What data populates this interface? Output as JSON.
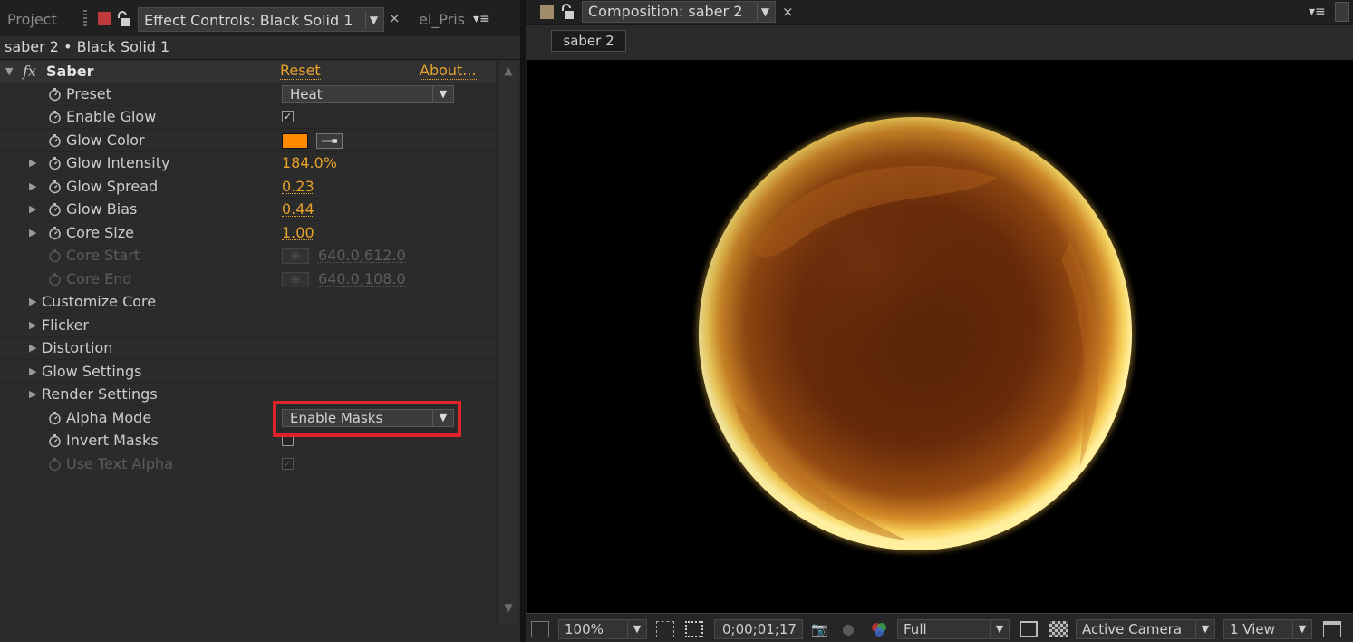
{
  "left_panel": {
    "tabs": {
      "project": "Project",
      "effect_controls": "Effect Controls: Black Solid 1",
      "other": "el_Pris"
    },
    "breadcrumb": "saber 2 • Black Solid 1",
    "effect": {
      "fx_icon": "fx",
      "name": "Saber",
      "reset": "Reset",
      "about": "About..."
    },
    "properties": [
      {
        "label": "Preset",
        "value": "Heat"
      },
      {
        "label": "Enable Glow",
        "checked": true
      },
      {
        "label": "Glow Color",
        "color": "#ff8a00"
      },
      {
        "label": "Glow Intensity",
        "value": "184.0%"
      },
      {
        "label": "Glow Spread",
        "value": "0.23"
      },
      {
        "label": "Glow Bias",
        "value": "0.44"
      },
      {
        "label": "Core Size",
        "value": "1.00"
      },
      {
        "label": "Core Start",
        "value": "640.0,612.0"
      },
      {
        "label": "Core End",
        "value": "640.0,108.0"
      },
      {
        "label": "Customize Core"
      },
      {
        "label": "Flicker"
      },
      {
        "label": "Distortion"
      },
      {
        "label": "Glow Settings"
      },
      {
        "label": "Render Settings"
      },
      {
        "label": "Alpha Mode",
        "value": "Enable Masks"
      },
      {
        "label": "Invert Masks",
        "checked": false
      },
      {
        "label": "Use Text Alpha",
        "checked": true
      }
    ]
  },
  "right_panel": {
    "tab": "Composition: saber 2",
    "comp_button": "saber 2",
    "toolbar": {
      "zoom": "100%",
      "timecode": "0;00;01;17",
      "resolution": "Full",
      "camera": "Active Camera",
      "views": "1 View"
    }
  },
  "colors": {
    "accent_value": "#e6a12b",
    "highlight_box": "#e0232a",
    "glow_color": "#ff8a00"
  }
}
